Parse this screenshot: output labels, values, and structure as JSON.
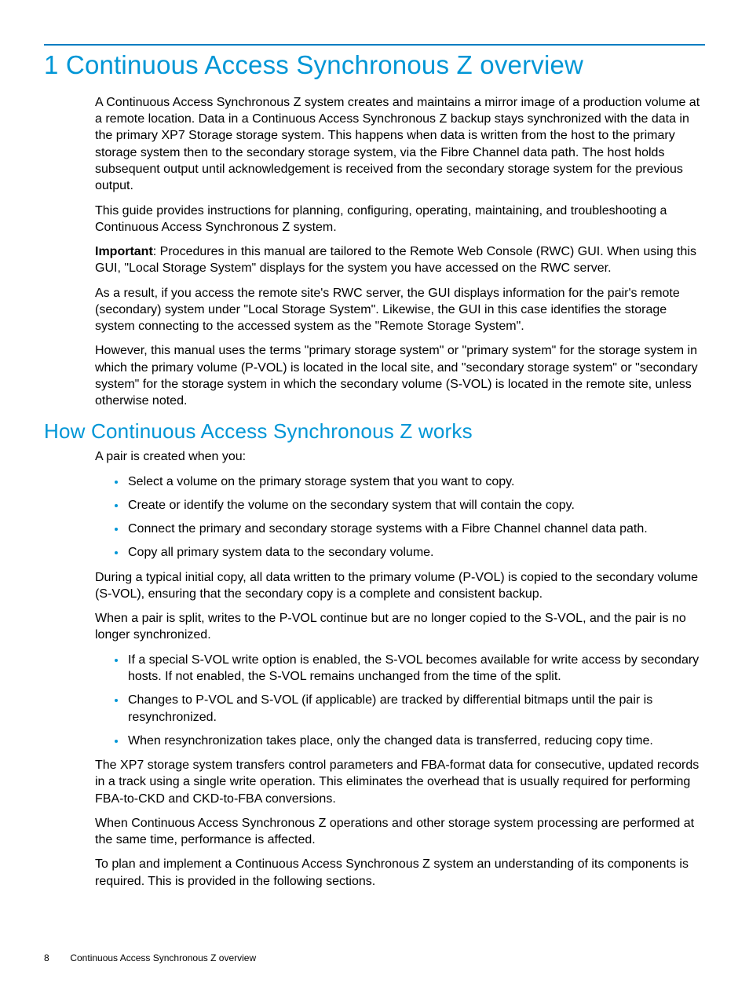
{
  "title": "1 Continuous Access Synchronous Z overview",
  "p1": "A Continuous Access Synchronous Z system creates and maintains a mirror image of a production volume at a remote location. Data in a Continuous Access Synchronous Z backup stays synchronized with the data in the primary XP7 Storage storage system. This happens when data is written from the host to the primary storage system then to the secondary storage system, via the Fibre Channel data path. The host holds subsequent output until acknowledgement is received from the secondary storage system for the previous output.",
  "p2": "This guide provides instructions for planning, configuring, operating, maintaining, and troubleshooting a Continuous Access Synchronous Z system.",
  "p3_strong": "Important",
  "p3_rest": ": Procedures in this manual are tailored to the Remote Web Console (RWC) GUI. When using this GUI, \"Local Storage System\" displays for the system you have accessed on the RWC server.",
  "p4": "As a result, if you access the remote site's RWC server, the GUI displays information for the pair's remote (secondary) system under \"Local Storage System\". Likewise, the GUI in this case identifies the storage system connecting to the accessed system as the \"Remote Storage System\".",
  "p5": "However, this manual uses the terms \"primary storage system\" or \"primary system\" for the storage system in which the primary volume (P-VOL) is located in the local site, and \"secondary storage system\" or \"secondary system\" for the storage system in which the secondary volume (S-VOL) is located in the remote site, unless otherwise noted.",
  "h2": "How Continuous Access Synchronous Z works",
  "p6": "A pair is created when you:",
  "list1": {
    "i0": "Select a volume on the primary storage system that you want to copy.",
    "i1": "Create or identify the volume on the secondary system that will contain the copy.",
    "i2": "Connect the primary and secondary storage systems with a Fibre Channel channel data path.",
    "i3": "Copy all primary system data to the secondary volume."
  },
  "p7": "During a typical initial copy, all data written to the primary volume (P-VOL) is copied to the secondary volume (S-VOL), ensuring that the secondary copy is a complete and consistent backup.",
  "p8": "When a pair is split, writes to the P-VOL continue but are no longer copied to the S-VOL, and the pair is no longer synchronized.",
  "list2": {
    "i0": "If a special S-VOL write option is enabled, the S-VOL becomes available for write access by secondary hosts. If not enabled, the S-VOL remains unchanged from the time of the split.",
    "i1": "Changes to P-VOL and S-VOL (if applicable) are tracked by differential bitmaps until the pair is resynchronized.",
    "i2": "When resynchronization takes place, only the changed data is transferred, reducing copy time."
  },
  "p9": "The XP7 storage system transfers control parameters and FBA-format data for consecutive, updated records in a track using a single write operation. This eliminates the overhead that is usually required for performing FBA-to-CKD and CKD-to-FBA conversions.",
  "p10": "When Continuous Access Synchronous Z operations and other storage system processing are performed at the same time, performance is affected.",
  "p11": "To plan and implement a Continuous Access Synchronous Z system an understanding of its components is required. This is provided in the following sections.",
  "footer": {
    "page": "8",
    "label": "Continuous Access Synchronous Z overview"
  }
}
